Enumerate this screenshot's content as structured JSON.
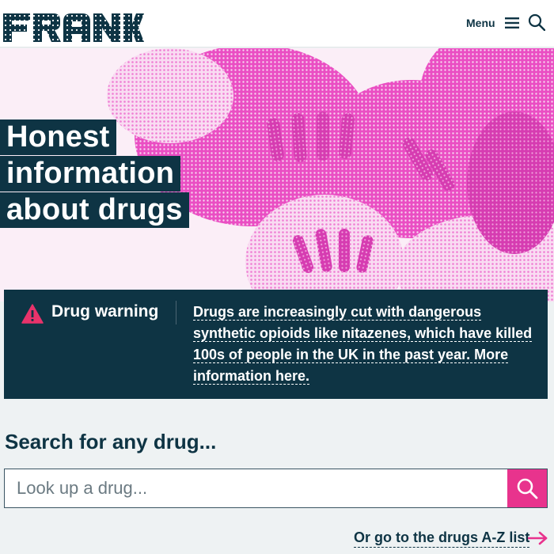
{
  "header": {
    "logo_text": "FRANK",
    "menu_label": "Menu",
    "menu_icon": "hamburger-icon",
    "search_icon": "search-icon"
  },
  "hero": {
    "title_lines": [
      "Honest",
      "information",
      "about drugs"
    ],
    "image": "pink halftone pills"
  },
  "warning": {
    "icon": "warning-triangle-icon",
    "title": "Drug warning",
    "text": "Drugs are increasingly cut with dangerous synthetic opioids like nitazenes, which have killed 100s of people in the UK in the past year. More information here."
  },
  "search": {
    "heading": "Search for any drug...",
    "placeholder": "Look up a drug...",
    "value": "",
    "button_icon": "search-icon"
  },
  "az_link": {
    "label": "Or go to the drugs A-Z list",
    "icon": "arrow-right-icon"
  },
  "colors": {
    "brand_dark": "#0e3444",
    "accent_pink": "#e8338d",
    "background": "#eef2f3",
    "warning_red": "#e8336b"
  }
}
